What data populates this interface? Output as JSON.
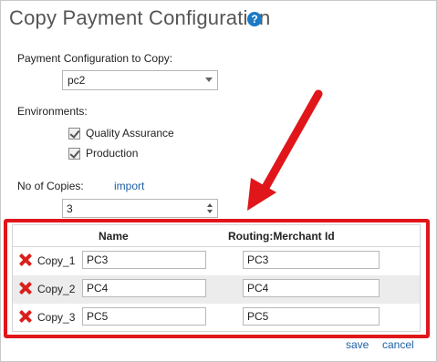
{
  "dialog": {
    "title": "Copy Payment Configuration",
    "help_glyph": "?"
  },
  "source": {
    "label": "Payment Configuration to Copy:",
    "selected": "pc2"
  },
  "environments": {
    "label": "Environments:",
    "options": [
      {
        "label": "Quality Assurance",
        "checked": true
      },
      {
        "label": "Production",
        "checked": true
      }
    ]
  },
  "copies": {
    "label": "No of Copies:",
    "import_label": "import",
    "value": "3"
  },
  "table": {
    "headers": {
      "name": "Name",
      "routing": "Routing:Merchant Id"
    },
    "rows": [
      {
        "label": "Copy_1",
        "name": "PC3",
        "merchant": "PC3"
      },
      {
        "label": "Copy_2",
        "name": "PC4",
        "merchant": "PC4"
      },
      {
        "label": "Copy_3",
        "name": "PC5",
        "merchant": "PC5"
      }
    ]
  },
  "footer": {
    "save": "save",
    "cancel": "cancel"
  },
  "colors": {
    "highlight": "#e0161b",
    "arrow": "#e0161b",
    "link": "#1d5fa6",
    "help": "#1b7ac6"
  }
}
